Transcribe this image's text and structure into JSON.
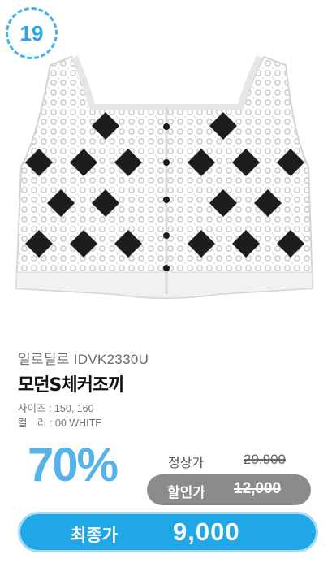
{
  "badge": {
    "number": "19",
    "color": "#3fb3ea"
  },
  "product": {
    "brand": "일로딜로 IDVK2330U",
    "name": "모던S체커조끼",
    "size_line": "사이즈 : 150, 160",
    "color_line": "컬　러 : 00 WHITE",
    "image_icon": "crochet-checker-vest"
  },
  "price": {
    "discount_rate": "70%",
    "regular_label": "정상가",
    "regular_price": "29,900",
    "sale_label": "할인가",
    "sale_price": "12,000",
    "final_label": "최종가",
    "final_price": "9,000"
  },
  "colors": {
    "accent": "#1fa7e8",
    "percent": "#55b3ea",
    "sale_pill": "#8b8b8b"
  }
}
